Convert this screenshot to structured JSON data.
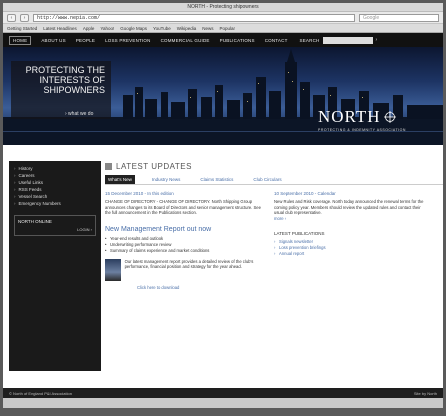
{
  "browser": {
    "window_title": "NORTH - Protecting shipowners",
    "url": "http://www.nepia.com/",
    "search_placeholder": "Google",
    "bookmarks": [
      "Getting Started",
      "Latest Headlines",
      "Apple",
      "Yahoo!",
      "Google Maps",
      "YouTube",
      "Wikipedia",
      "News",
      "Popular"
    ]
  },
  "sitenav": {
    "items": [
      "Home",
      "About Us",
      "People",
      "Loss Prevention",
      "Commercial Guide",
      "Publications",
      "Contact"
    ],
    "search_label": "Search",
    "go": "›"
  },
  "hero": {
    "title": "Protecting the interests of shipowners",
    "link": "› what we do",
    "logo": "NORTH",
    "logo_sub": "Protecting & Indemnity Association"
  },
  "sidebar": {
    "items": [
      "History",
      "Careers",
      "Useful Links",
      "RSS Feeds",
      "Vessel Search",
      "Emergency Numbers"
    ],
    "online_title": "North Online",
    "login": "LOGIN ›"
  },
  "main": {
    "latest_title": "Latest Updates",
    "tabs": [
      "What's New",
      "Industry News",
      "Claims Statistics",
      "Club Circulars"
    ],
    "news_left": {
      "date": "15 December 2010 - In this edition",
      "text": "CHANGE OF DIRECTORY - CHANGE OF DIRECTORY. North Shipping Group announces changes to its Board of Directors and senior management structure. See the full announcement in the Publications section."
    },
    "news_right": {
      "date": "10 September 2010 - Calendar",
      "text": "New Rules and Risk coverage. North today announced the renewal terms for the coming policy year. Members should review the updated rules and contact their usual club representative.",
      "link": "more ›"
    },
    "mgmt_title": "New Management Report out now",
    "bullets": [
      "Year-end results and outlook",
      "Underwriting performance review",
      "Summary of claims experience and market conditions"
    ],
    "report_text": "Our latest management report provides a detailed review of the club's performance, financial position and strategy for the year ahead.",
    "more_link": "Click here to download",
    "downloads_title": "Latest Publications",
    "downloads": [
      "Signals newsletter",
      "Loss prevention briefings",
      "Annual report"
    ]
  },
  "status": {
    "left": "© North of England P&I Association",
    "right": "Site by North"
  }
}
